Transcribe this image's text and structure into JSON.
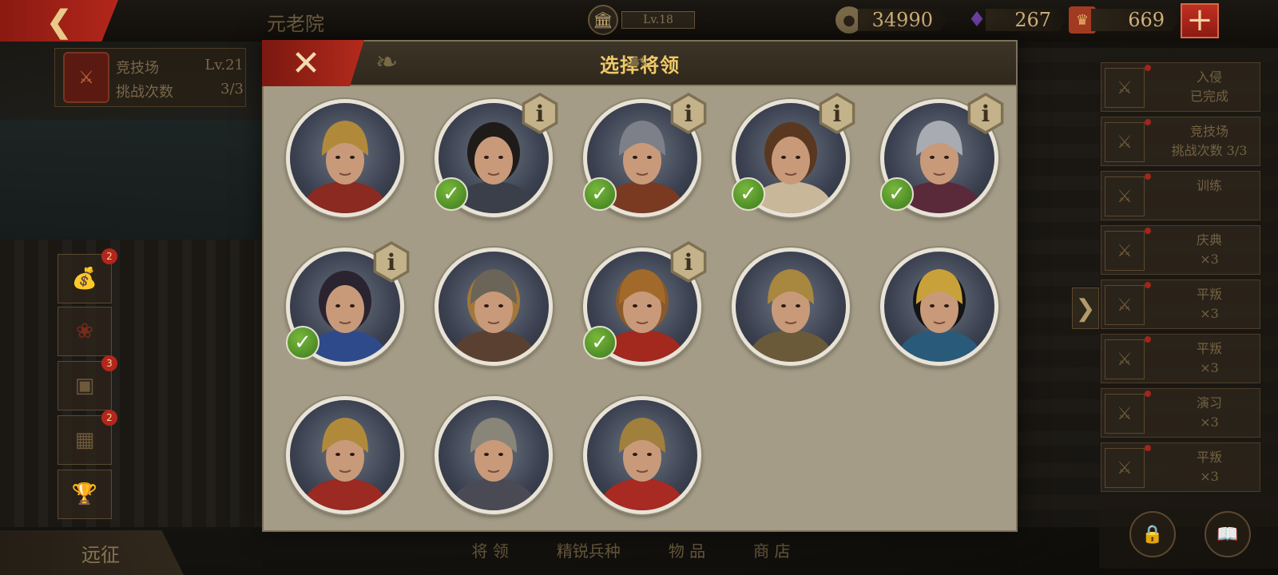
{
  "top_bar": {
    "back_icon": "chevron-left-icon",
    "title": "元老院",
    "senate_level": "Lv.18",
    "coins": "34990",
    "gems": "267",
    "tokens": "669"
  },
  "left_panel": {
    "arena_label": "竞技场",
    "arena_level": "Lv.21",
    "challenge_label": "挑战次数",
    "challenge_value": "3/3",
    "badges": [
      "2",
      "3",
      "2"
    ],
    "expedition": "远征"
  },
  "bottom_tabs": [
    "将 领",
    "精锐兵种",
    "物 品",
    "商 店"
  ],
  "quests": [
    {
      "title": "入侵",
      "sub": "已完成"
    },
    {
      "title": "竞技场",
      "sub": "挑战次数 3/3"
    },
    {
      "title": "训练",
      "sub": ""
    },
    {
      "title": "庆典",
      "sub": "×3"
    },
    {
      "title": "平叛",
      "sub": "×3"
    },
    {
      "title": "平叛",
      "sub": "×3"
    },
    {
      "title": "演习",
      "sub": "×3"
    },
    {
      "title": "平叛",
      "sub": "×3"
    }
  ],
  "modal": {
    "title": "选择将领",
    "close_icon": "close-icon",
    "info_glyph": "i",
    "check_glyph": "✓",
    "generals": [
      {
        "id": "roman-centurion-gold",
        "info": false,
        "checked": false
      },
      {
        "id": "eastern-warlord",
        "info": true,
        "checked": true
      },
      {
        "id": "steel-helmet-warrior",
        "info": true,
        "checked": true
      },
      {
        "id": "young-roman",
        "info": true,
        "checked": true
      },
      {
        "id": "silver-helmet-warrior",
        "info": true,
        "checked": true
      },
      {
        "id": "dark-haired-officer",
        "info": true,
        "checked": true
      },
      {
        "id": "viking-chieftain",
        "info": false,
        "checked": false
      },
      {
        "id": "lion-pelt-hero",
        "info": true,
        "checked": true
      },
      {
        "id": "crested-legionary",
        "info": false,
        "checked": false
      },
      {
        "id": "egyptian-queen",
        "info": false,
        "checked": false
      },
      {
        "id": "roman-legate-white",
        "info": false,
        "checked": false
      },
      {
        "id": "roman-legate-black",
        "info": false,
        "checked": false
      },
      {
        "id": "roman-legate-red",
        "info": false,
        "checked": false
      }
    ]
  },
  "colors": {
    "accent_red": "#b3261b",
    "title_gold": "#f0c968",
    "check_green": "#4f9a28",
    "modal_bg": "#a49c86"
  }
}
